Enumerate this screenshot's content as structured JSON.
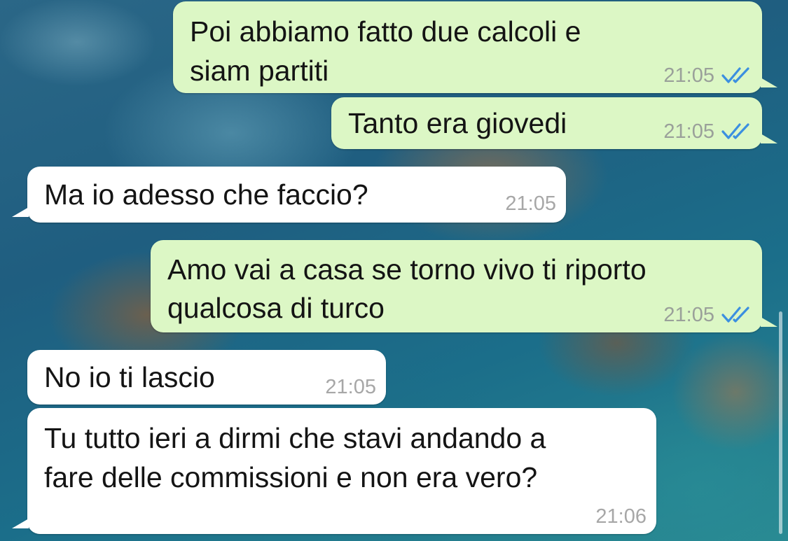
{
  "colors": {
    "outgoing_bubble": "#dcf7c5",
    "incoming_bubble": "#ffffff",
    "read_ticks": "#3b8fe0",
    "timestamp": "#9aa09a"
  },
  "messages": [
    {
      "direction": "outgoing",
      "lines": [
        "Poi abbiamo fatto due calcoli e",
        "siam partiti"
      ],
      "time": "21:05",
      "status_icon": "double-check-read"
    },
    {
      "direction": "outgoing",
      "lines": [
        "Tanto era giovedi"
      ],
      "time": "21:05",
      "status_icon": "double-check-read"
    },
    {
      "direction": "incoming",
      "lines": [
        "Ma io adesso che faccio?"
      ],
      "time": "21:05"
    },
    {
      "direction": "outgoing",
      "lines": [
        "Amo vai a casa se torno vivo ti riporto",
        "qualcosa di turco"
      ],
      "time": "21:05",
      "status_icon": "double-check-read"
    },
    {
      "direction": "incoming",
      "lines": [
        "No io ti lascio"
      ],
      "time": "21:05"
    },
    {
      "direction": "incoming",
      "lines": [
        "Tu tutto ieri a dirmi che stavi andando a",
        "fare delle commissioni e non era vero?"
      ],
      "time": "21:06"
    }
  ]
}
